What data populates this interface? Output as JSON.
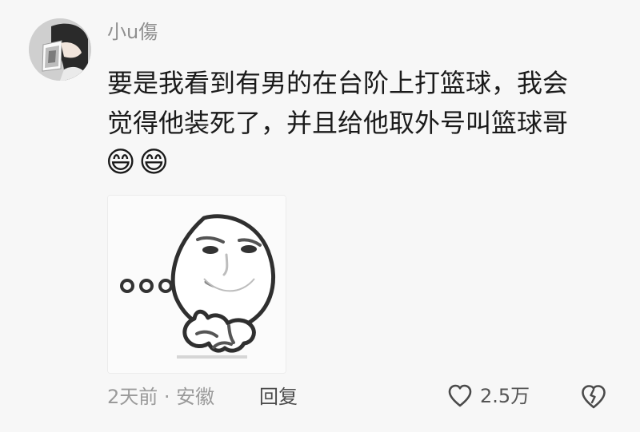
{
  "comment": {
    "username": "小u傷",
    "text_lines": [
      "要是我看到有男的在台阶上打篮球，我会",
      "觉得他装死了，并且给他取外号叫篮球哥"
    ],
    "emojis": [
      "😄",
      "😄"
    ],
    "meta": "2天前 · 安徽",
    "reply_label": "回复",
    "like_count": "2.5万"
  },
  "icons": {
    "like": "heart-outline-icon",
    "dislike": "broken-heart-icon"
  },
  "colors": {
    "background": "#f7f7f7",
    "text": "#1b1b1b",
    "muted": "#9a9a9a",
    "username": "#8f8f8f"
  }
}
